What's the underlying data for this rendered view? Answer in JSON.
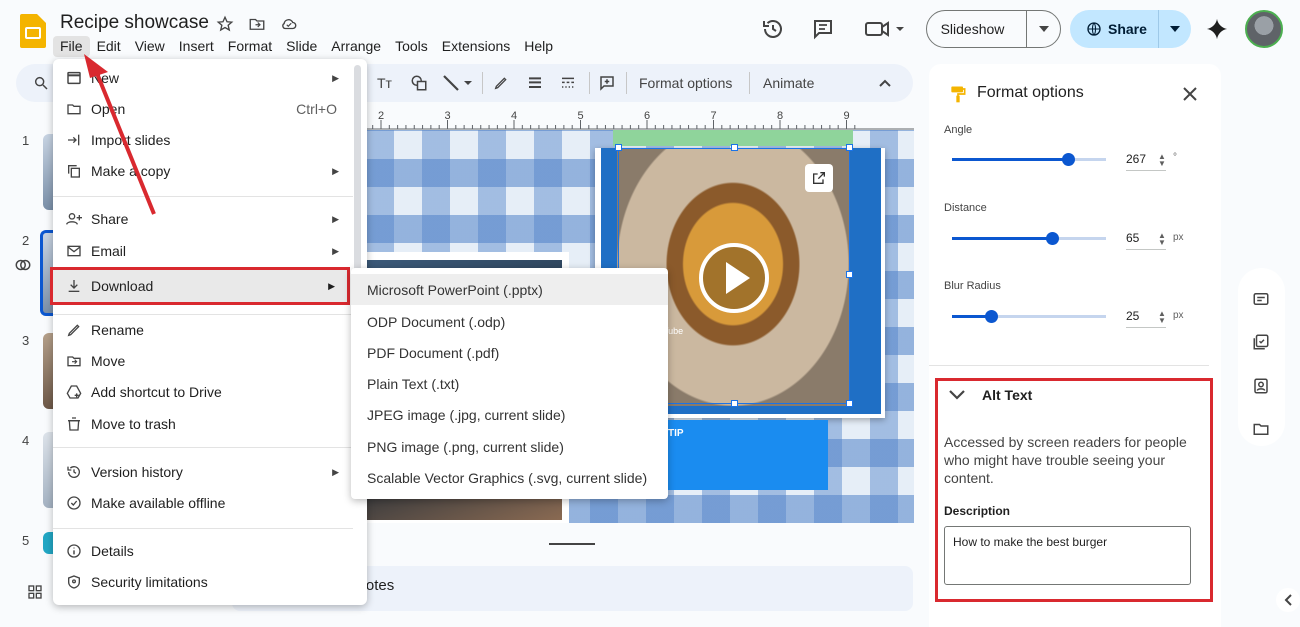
{
  "app": {
    "doc_title": "Recipe showcase"
  },
  "menubar": [
    "File",
    "Edit",
    "View",
    "Insert",
    "Format",
    "Slide",
    "Arrange",
    "Tools",
    "Extensions",
    "Help"
  ],
  "header": {
    "slideshow_label": "Slideshow",
    "share_label": "Share"
  },
  "toolbar": {
    "format_options": "Format options",
    "animate": "Animate"
  },
  "ruler_ticks": [
    "2",
    "3",
    "4",
    "5",
    "6",
    "7",
    "8",
    "9"
  ],
  "filmstrip": {
    "slide_numbers": [
      "1",
      "2",
      "3",
      "4",
      "5"
    ]
  },
  "file_menu": {
    "items": [
      {
        "label": "New",
        "icon": "new-icon",
        "submenu": true
      },
      {
        "label": "Open",
        "icon": "folder-icon",
        "shortcut": "Ctrl+O"
      },
      {
        "label": "Import slides",
        "icon": "import-icon"
      },
      {
        "label": "Make a copy",
        "icon": "copy-icon",
        "submenu": true
      },
      {
        "label": "Share",
        "icon": "person-add-icon",
        "submenu": true
      },
      {
        "label": "Email",
        "icon": "email-icon",
        "submenu": true
      },
      {
        "label": "Download",
        "icon": "download-icon",
        "submenu": true
      },
      {
        "label": "Rename",
        "icon": "rename-icon"
      },
      {
        "label": "Move",
        "icon": "move-icon"
      },
      {
        "label": "Add shortcut to Drive",
        "icon": "drive-shortcut-icon"
      },
      {
        "label": "Move to trash",
        "icon": "trash-icon"
      },
      {
        "label": "Version history",
        "icon": "history-icon",
        "submenu": true
      },
      {
        "label": "Make available offline",
        "icon": "offline-icon"
      },
      {
        "label": "Details",
        "icon": "info-icon"
      },
      {
        "label": "Security limitations",
        "icon": "shield-icon"
      }
    ]
  },
  "download_submenu": {
    "items": [
      "Microsoft PowerPoint (.pptx)",
      "ODP Document (.odp)",
      "PDF Document (.pdf)",
      "Plain Text (.txt)",
      "JPEG image (.jpg, current slide)",
      "PNG image (.png, current slide)",
      "Scalable Vector Graphics (.svg, current slide)"
    ]
  },
  "slide": {
    "tip_label": "TIP",
    "video_caption": "Tube"
  },
  "speaker_notes": {
    "placeholder": "er notes"
  },
  "format_panel": {
    "title": "Format options",
    "angle": {
      "label": "Angle",
      "value": "267",
      "unit": "°",
      "level": 0.75
    },
    "distance": {
      "label": "Distance",
      "value": "65",
      "unit": "px",
      "level": 0.65
    },
    "blur": {
      "label": "Blur Radius",
      "value": "25",
      "unit": "px",
      "level": 0.25
    },
    "alt_text": {
      "title": "Alt Text",
      "description_help": "Accessed by screen readers for people who might have trouble seeing your content.",
      "description_label": "Description",
      "description_value": "How to make the best burger"
    }
  },
  "colors": {
    "highlight": "#d9292f",
    "accent": "#0b57d0",
    "share_bg": "#c2e7ff"
  }
}
